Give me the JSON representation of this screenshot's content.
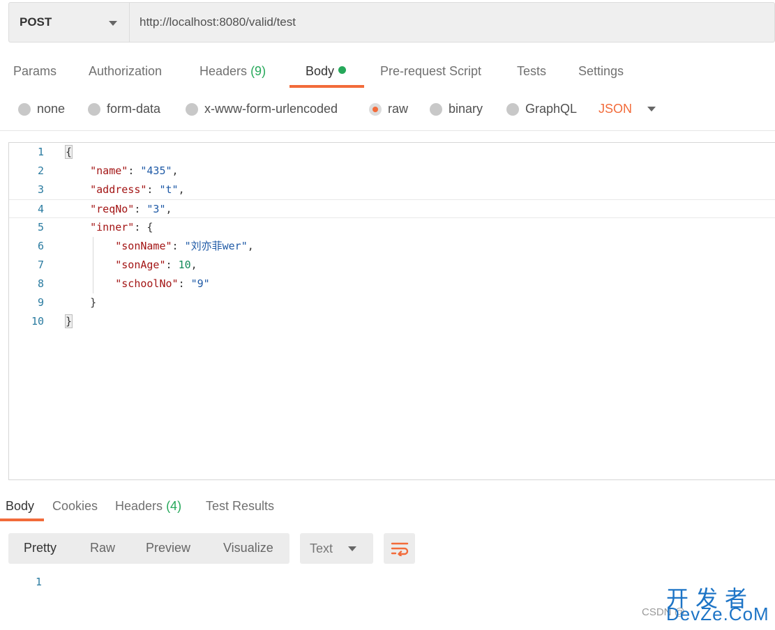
{
  "request": {
    "method": "POST",
    "url": "http://localhost:8080/valid/test"
  },
  "request_tabs": {
    "params": "Params",
    "authorization": "Authorization",
    "headers": "Headers",
    "headers_count": "(9)",
    "body": "Body",
    "pre_request": "Pre-request Script",
    "tests": "Tests",
    "settings": "Settings"
  },
  "body_types": {
    "none": "none",
    "form_data": "form-data",
    "urlencoded": "x-www-form-urlencoded",
    "raw": "raw",
    "binary": "binary",
    "graphql": "GraphQL",
    "selected": "raw",
    "format": "JSON"
  },
  "editor": {
    "line_numbers": [
      "1",
      "2",
      "3",
      "4",
      "5",
      "6",
      "7",
      "8",
      "9",
      "10"
    ],
    "lines": [
      {
        "indent": "",
        "key": "",
        "value": "",
        "text": "{"
      },
      {
        "indent": "    ",
        "key": "\"name\"",
        "value": "\"435\"",
        "value_type": "string",
        "suffix": ","
      },
      {
        "indent": "    ",
        "key": "\"address\"",
        "value": "\"t\"",
        "value_type": "string",
        "suffix": ","
      },
      {
        "indent": "    ",
        "key": "\"reqNo\"",
        "value": "\"3\"",
        "value_type": "string",
        "suffix": ","
      },
      {
        "indent": "    ",
        "key": "\"inner\"",
        "value": "{",
        "value_type": "punct",
        "suffix": ""
      },
      {
        "indent": "        ",
        "key": "\"sonName\"",
        "value": "\"刘亦菲wer\"",
        "value_type": "string",
        "suffix": ","
      },
      {
        "indent": "        ",
        "key": "\"sonAge\"",
        "value": "10",
        "value_type": "number",
        "suffix": ","
      },
      {
        "indent": "        ",
        "key": "\"schoolNo\"",
        "value": "\"9\"",
        "value_type": "string",
        "suffix": ""
      },
      {
        "indent": "    ",
        "key": "",
        "value": "",
        "text": "}"
      },
      {
        "indent": "",
        "key": "",
        "value": "",
        "text": "}"
      }
    ]
  },
  "response_tabs": {
    "body": "Body",
    "cookies": "Cookies",
    "headers": "Headers",
    "headers_count": "(4)",
    "test_results": "Test Results"
  },
  "response_view": {
    "pretty": "Pretty",
    "raw": "Raw",
    "preview": "Preview",
    "visualize": "Visualize",
    "format": "Text",
    "line_number": "1"
  },
  "watermark": {
    "top": "开发者",
    "brand": "DevZe.CoM",
    "bottom": "CSDN @"
  },
  "colors": {
    "accent": "#f26b3a",
    "green": "#26a85a",
    "key": "#a31515",
    "string": "#1f5aa6",
    "number": "#128a5a"
  }
}
